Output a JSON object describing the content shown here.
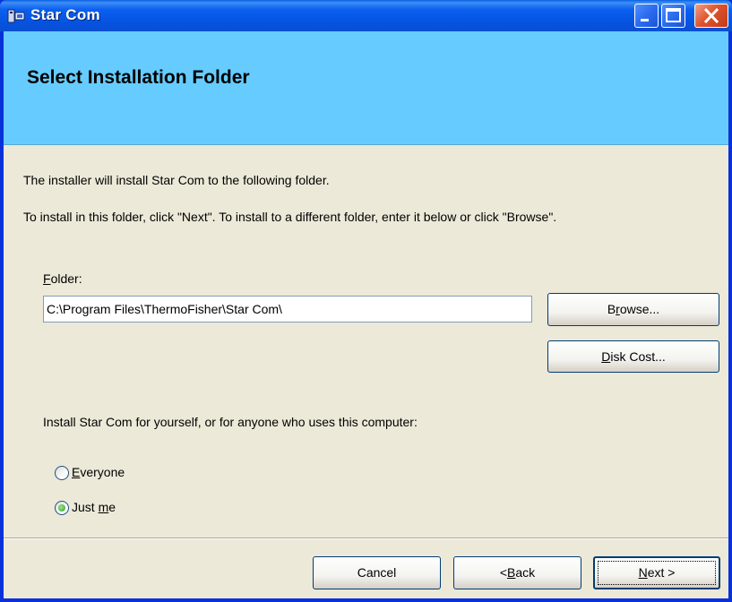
{
  "window": {
    "title": "Star Com",
    "icon": "installer-app-icon",
    "controls": {
      "minimize": "minimize-icon",
      "maximize": "maximize-icon",
      "close": "close-icon"
    }
  },
  "banner": {
    "title": "Select Installation Folder"
  },
  "intro": {
    "line1": "The installer will install Star Com to the following folder.",
    "line2": "To install in this folder, click \"Next\". To install to a different folder, enter it below or click \"Browse\"."
  },
  "folder": {
    "label_mnemonic": "F",
    "label_rest": "older:",
    "value": "C:\\Program Files\\ThermoFisher\\Star Com\\"
  },
  "buttons": {
    "browse": {
      "pre": "B",
      "mnemonic": "r",
      "post": "owse..."
    },
    "disk_cost": {
      "pre": "",
      "mnemonic": "D",
      "post": "isk Cost..."
    },
    "cancel": "Cancel",
    "back": {
      "pre": "< ",
      "mnemonic": "B",
      "post": "ack"
    },
    "next": {
      "pre": "",
      "mnemonic": "N",
      "post": "ext >"
    }
  },
  "install_for": {
    "prompt": "Install Star Com for yourself, or for anyone who uses this computer:",
    "options": [
      {
        "pre": "",
        "mnemonic": "E",
        "post": "veryone",
        "selected": false
      },
      {
        "pre": "Just ",
        "mnemonic": "m",
        "post": "e",
        "selected": true
      }
    ]
  },
  "colors": {
    "banner": "#66ccff",
    "titlebar": "#0553e1",
    "client": "#ece9d8",
    "close": "#e0542f"
  }
}
